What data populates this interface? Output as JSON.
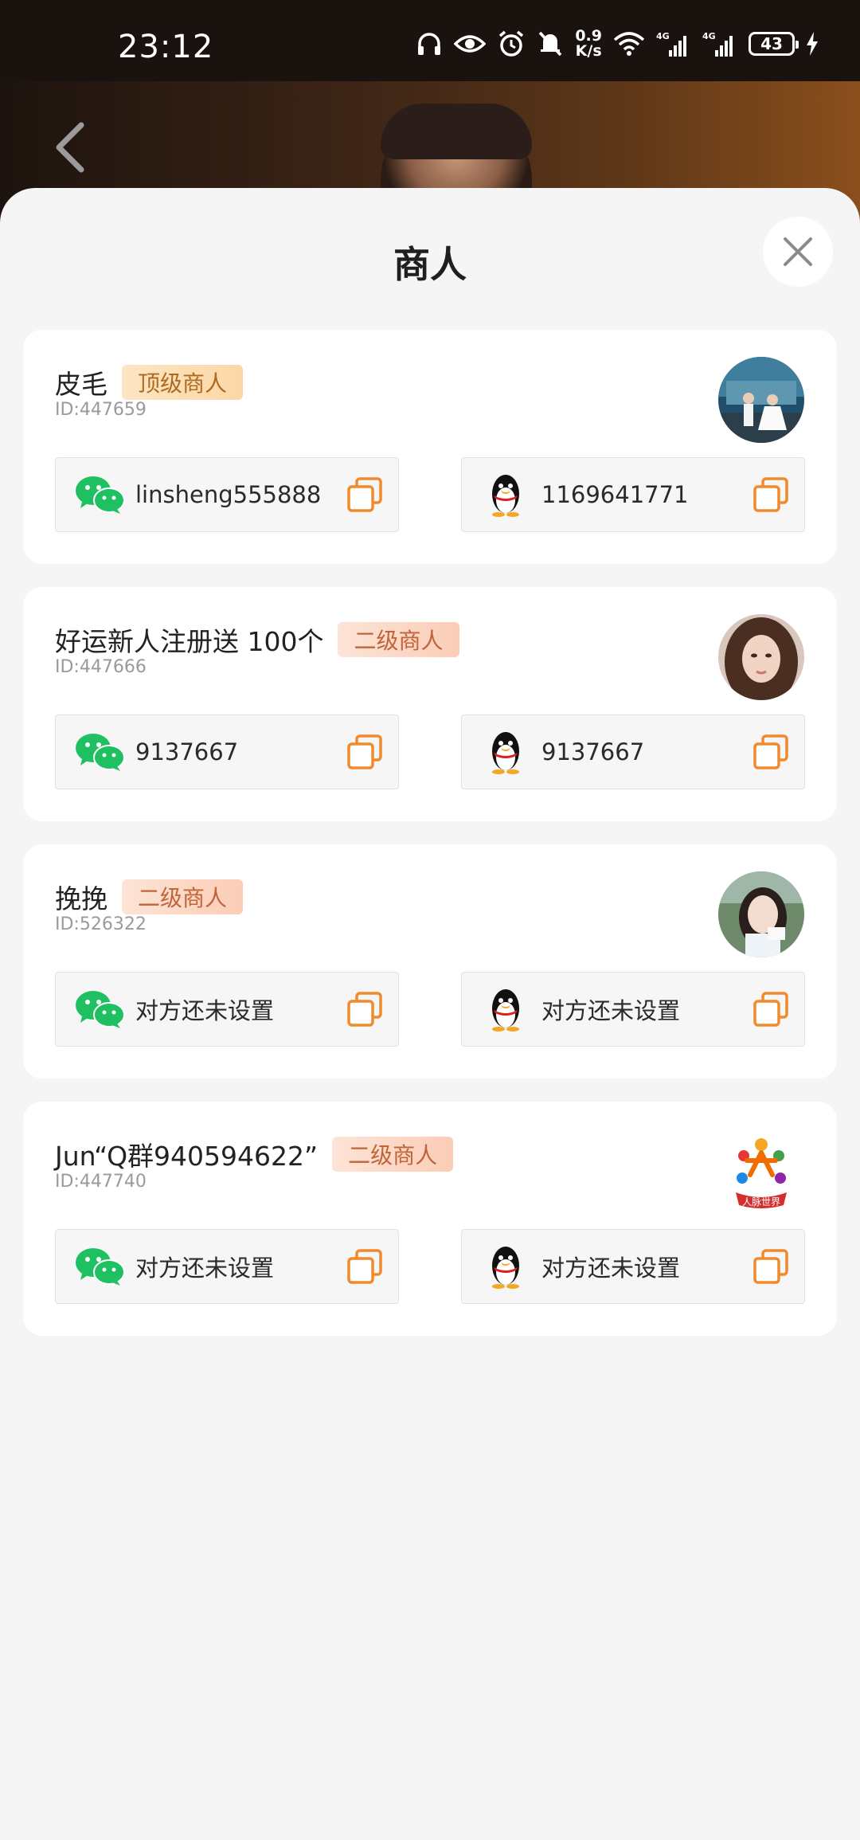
{
  "status_bar": {
    "time": "23:12",
    "net_speed_value": "0.9",
    "net_speed_unit": "K/s",
    "signal_1": "4G",
    "signal_2": "4G",
    "battery": "43"
  },
  "sheet": {
    "title": "商人",
    "close_icon": "close-icon"
  },
  "merchants": [
    {
      "name": "皮毛",
      "badge": "顶级商人",
      "badge_type": "top",
      "id": "ID:447659",
      "wechat": "linsheng555888",
      "qq": "1169641771"
    },
    {
      "name": "好运新人注册送 100个",
      "badge": "二级商人",
      "badge_type": "second",
      "id": "ID:447666",
      "wechat": "9137667",
      "qq": "9137667"
    },
    {
      "name": "挽挽",
      "badge": "二级商人",
      "badge_type": "second",
      "id": "ID:526322",
      "wechat": "对方还未设置",
      "qq": "对方还未设置"
    },
    {
      "name": "Jun“Q群940594622”",
      "badge": "二级商人",
      "badge_type": "second",
      "id": "ID:447740",
      "wechat": "对方还未设置",
      "qq": "对方还未设置",
      "avatar_text": "人脉世界"
    }
  ],
  "colors": {
    "wechat_green": "#1fc061",
    "copy_orange": "#f08a2c",
    "sheet_bg": "#f5f5f5"
  }
}
